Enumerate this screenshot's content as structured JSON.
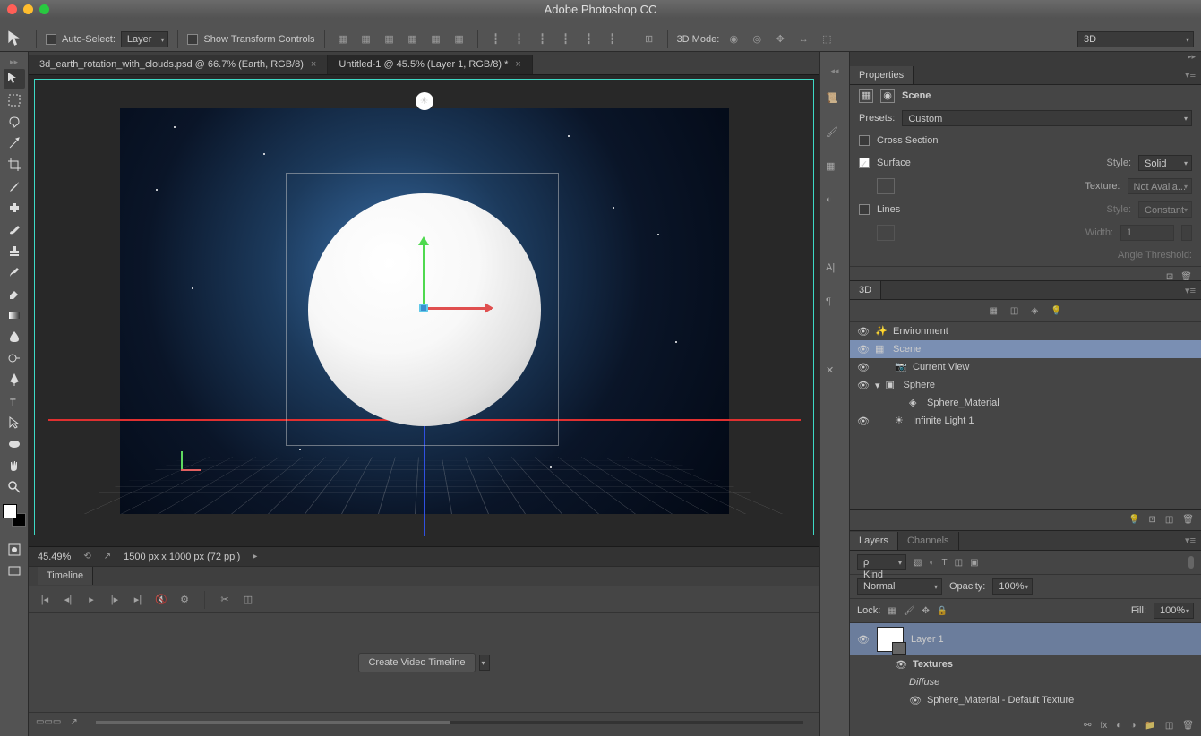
{
  "app": {
    "title": "Adobe Photoshop CC"
  },
  "options": {
    "auto_select": "Auto-Select:",
    "layer_dropdown": "Layer",
    "show_transform": "Show Transform Controls",
    "mode_label": "3D Mode:",
    "workspace": "3D"
  },
  "tabs": [
    {
      "label": "3d_earth_rotation_with_clouds.psd @ 66.7% (Earth, RGB/8)",
      "active": false
    },
    {
      "label": "Untitled-1 @ 45.5% (Layer 1, RGB/8) *",
      "active": true
    }
  ],
  "status": {
    "zoom": "45.49%",
    "docinfo": "1500 px x 1000 px (72 ppi)"
  },
  "timeline": {
    "title": "Timeline",
    "create": "Create Video Timeline"
  },
  "properties": {
    "title": "Properties",
    "scene_label": "Scene",
    "presets_label": "Presets:",
    "presets_value": "Custom",
    "cross_section": "Cross Section",
    "surface": "Surface",
    "style_label": "Style:",
    "style_value": "Solid",
    "texture_label": "Texture:",
    "texture_value": "Not Availa...",
    "lines": "Lines",
    "lines_style_label": "Style:",
    "lines_style_value": "Constant",
    "width_label": "Width:",
    "width_value": "1",
    "angle_label": "Angle Threshold:"
  },
  "panel3d": {
    "title": "3D",
    "items": [
      {
        "label": "Environment",
        "icon": "env",
        "indent": 0
      },
      {
        "label": "Scene",
        "icon": "scene",
        "indent": 0,
        "selected": true
      },
      {
        "label": "Current View",
        "icon": "camera",
        "indent": 1
      },
      {
        "label": "Sphere",
        "icon": "mesh",
        "indent": 0,
        "expand": true
      },
      {
        "label": "Sphere_Material",
        "icon": "material",
        "indent": 2
      },
      {
        "label": "Infinite Light 1",
        "icon": "light",
        "indent": 1
      }
    ]
  },
  "layers": {
    "tab_layers": "Layers",
    "tab_channels": "Channels",
    "kind": "Kind",
    "blend": "Normal",
    "opacity_label": "Opacity:",
    "opacity_value": "100%",
    "lock_label": "Lock:",
    "fill_label": "Fill:",
    "fill_value": "100%",
    "layer1": "Layer 1",
    "textures": "Textures",
    "diffuse": "Diffuse",
    "material": "Sphere_Material - Default Texture"
  }
}
